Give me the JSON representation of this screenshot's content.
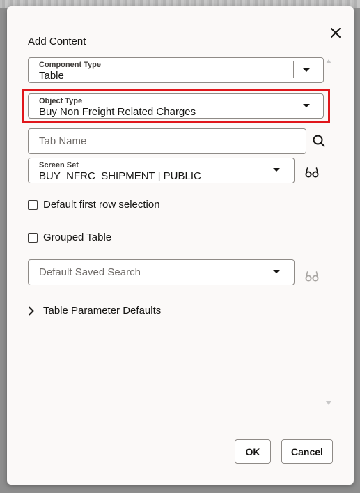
{
  "dialog": {
    "title": "Add Content",
    "component_type": {
      "label": "Component Type",
      "value": "Table"
    },
    "object_type": {
      "label": "Object Type",
      "value": "Buy Non Freight Related Charges"
    },
    "tab_name": {
      "placeholder": "Tab Name"
    },
    "screen_set": {
      "label": "Screen Set",
      "value": "BUY_NFRC_SHIPMENT | PUBLIC"
    },
    "default_first_row_selection": {
      "label": "Default first row selection",
      "checked": false
    },
    "grouped_table": {
      "label": "Grouped Table",
      "checked": false
    },
    "default_saved_search": {
      "placeholder": "Default Saved Search"
    },
    "table_parameter_defaults": {
      "label": "Table Parameter Defaults",
      "expanded": false
    },
    "buttons": {
      "ok": "OK",
      "cancel": "Cancel"
    }
  },
  "icons": {
    "close": "close-icon",
    "dropdown": "chevron-down-icon",
    "search": "search-icon",
    "view": "glasses-icon",
    "expand": "chevron-right-icon"
  },
  "colors": {
    "highlight": "#e0161b",
    "dialog_bg": "#fbf9f8",
    "backdrop": "#8e8e8e"
  }
}
